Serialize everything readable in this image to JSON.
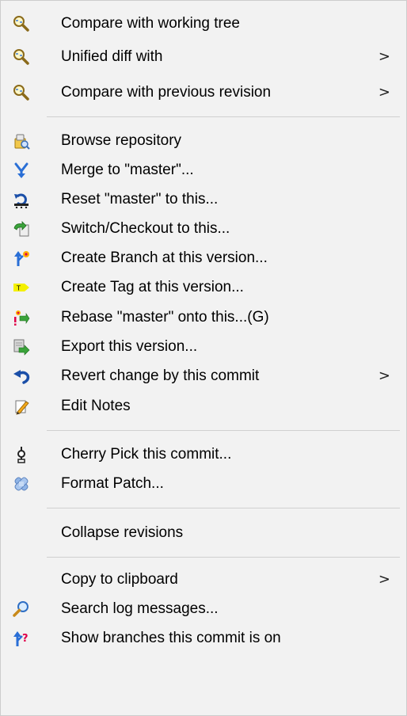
{
  "menu": {
    "items": [
      {
        "label": "Compare with working tree",
        "icon": "magnifier-compare-icon"
      },
      {
        "label": "Unified diff with",
        "icon": "magnifier-compare-icon",
        "submenu": ">"
      },
      {
        "label": "Compare with previous revision",
        "icon": "magnifier-compare-icon",
        "submenu": ">"
      },
      {
        "label": "Browse repository",
        "icon": "repo-browser-icon"
      },
      {
        "label": "Merge to \"master\"...",
        "icon": "merge-icon"
      },
      {
        "label": "Reset \"master\" to this...",
        "icon": "reset-icon"
      },
      {
        "label": "Switch/Checkout to this...",
        "icon": "switch-checkout-icon"
      },
      {
        "label": "Create Branch at this version...",
        "icon": "create-branch-icon"
      },
      {
        "label": "Create Tag at this version...",
        "icon": "create-tag-icon"
      },
      {
        "label": "Rebase \"master\" onto this...(G)",
        "icon": "rebase-icon"
      },
      {
        "label": "Export this version...",
        "icon": "export-icon"
      },
      {
        "label": "Revert change by this commit",
        "icon": "revert-icon",
        "submenu": ">"
      },
      {
        "label": "Edit Notes",
        "icon": "edit-notes-icon"
      },
      {
        "label": "Cherry Pick this commit...",
        "icon": "cherry-pick-icon"
      },
      {
        "label": "Format Patch...",
        "icon": "format-patch-icon"
      },
      {
        "label": "Collapse revisions",
        "icon": ""
      },
      {
        "label": "Copy to clipboard",
        "icon": "",
        "submenu": ">"
      },
      {
        "label": "Search log messages...",
        "icon": "search-icon"
      },
      {
        "label": "Show branches this commit is on",
        "icon": "show-branches-icon"
      }
    ]
  },
  "colors": {
    "menu_background": "#f2f2f2",
    "separator": "#d0d0d0",
    "text": "#000000"
  }
}
